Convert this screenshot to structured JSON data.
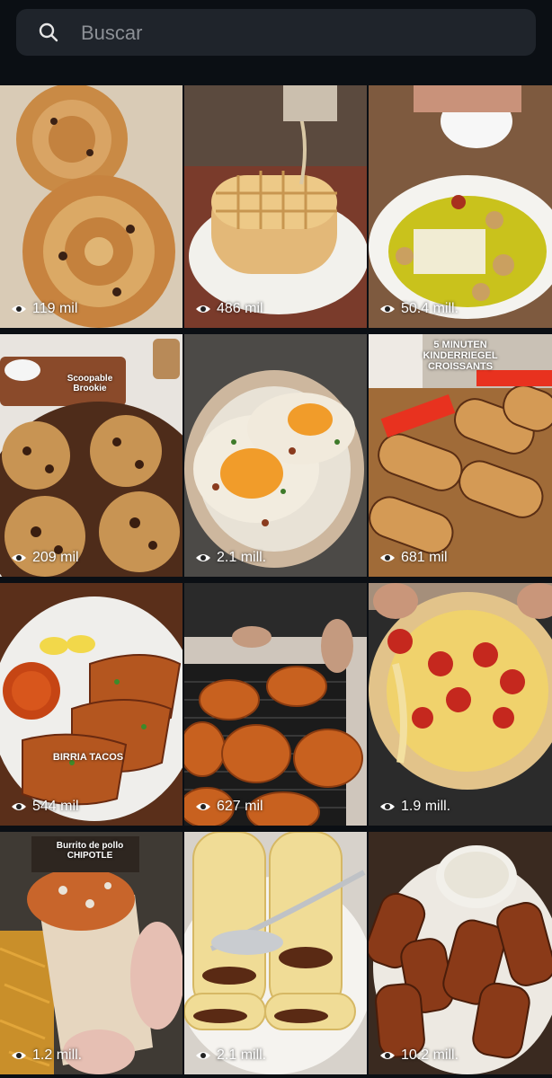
{
  "search": {
    "placeholder": "Buscar"
  },
  "tiles": [
    {
      "views": "119 mil"
    },
    {
      "views": "486 mil"
    },
    {
      "views": "50.4 mill."
    },
    {
      "views": "209 mil",
      "overlay_text": "Scoopable Brookie"
    },
    {
      "views": "2.1 mill."
    },
    {
      "views": "681 mil",
      "overlay_text": "5 MINUTEN KINDERRIEGEL CROISSANTS"
    },
    {
      "views": "544 mil",
      "overlay_text": "BIRRIA TACOS"
    },
    {
      "views": "627 mil"
    },
    {
      "views": "1.9 mill."
    },
    {
      "views": "1.2 mill.",
      "overlay_text": "Burrito de pollo CHIPOTLE"
    },
    {
      "views": "2.1 mill."
    },
    {
      "views": "10.2 mill."
    }
  ],
  "colors": {
    "background": "#0b0f14",
    "search_bg": "#1f242b"
  }
}
